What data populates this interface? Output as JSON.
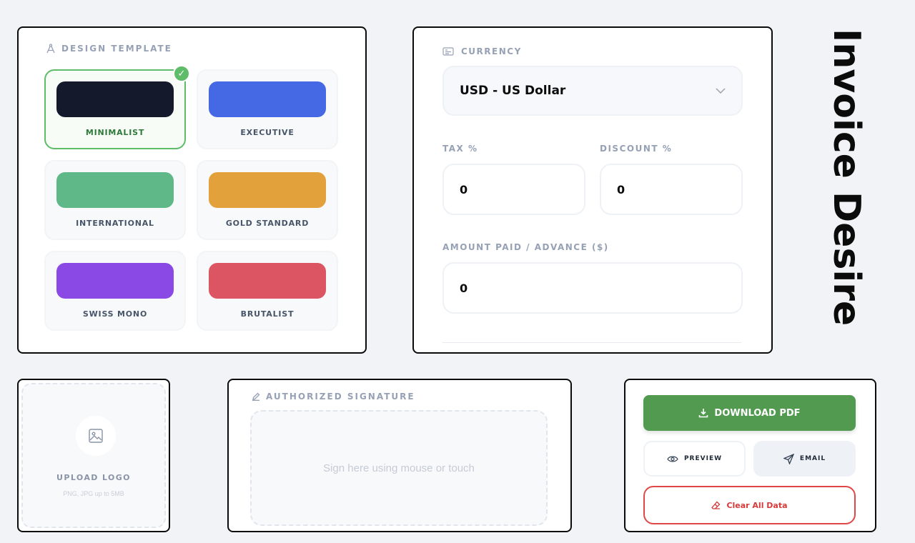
{
  "app": {
    "title": "Invoice Desire"
  },
  "design_template": {
    "heading": "DESIGN TEMPLATE",
    "selected": "MINIMALIST",
    "templates": [
      {
        "name": "MINIMALIST",
        "color": "#141a2c",
        "selected": true
      },
      {
        "name": "EXECUTIVE",
        "color": "#4568e4",
        "selected": false
      },
      {
        "name": "INTERNATIONAL",
        "color": "#5fb887",
        "selected": false
      },
      {
        "name": "GOLD STANDARD",
        "color": "#e3a13c",
        "selected": false
      },
      {
        "name": "SWISS MONO",
        "color": "#8a49e4",
        "selected": false
      },
      {
        "name": "BRUTALIST",
        "color": "#dc5562",
        "selected": false
      }
    ]
  },
  "currency": {
    "heading": "CURRENCY",
    "selected": "USD - US Dollar"
  },
  "tax": {
    "label": "TAX %",
    "value": "0"
  },
  "discount": {
    "label": "DISCOUNT %",
    "value": "0"
  },
  "amount_paid": {
    "label": "AMOUNT PAID / ADVANCE ($)",
    "value": "0"
  },
  "logo_upload": {
    "label": "UPLOAD LOGO",
    "hint": "PNG, JPG up to 5MB"
  },
  "signature": {
    "heading": "AUTHORIZED SIGNATURE",
    "placeholder": "Sign here using mouse or touch"
  },
  "actions": {
    "download": "DOWNLOAD PDF",
    "preview": "PREVIEW",
    "email": "EMAIL",
    "clear": "Clear All Data"
  }
}
